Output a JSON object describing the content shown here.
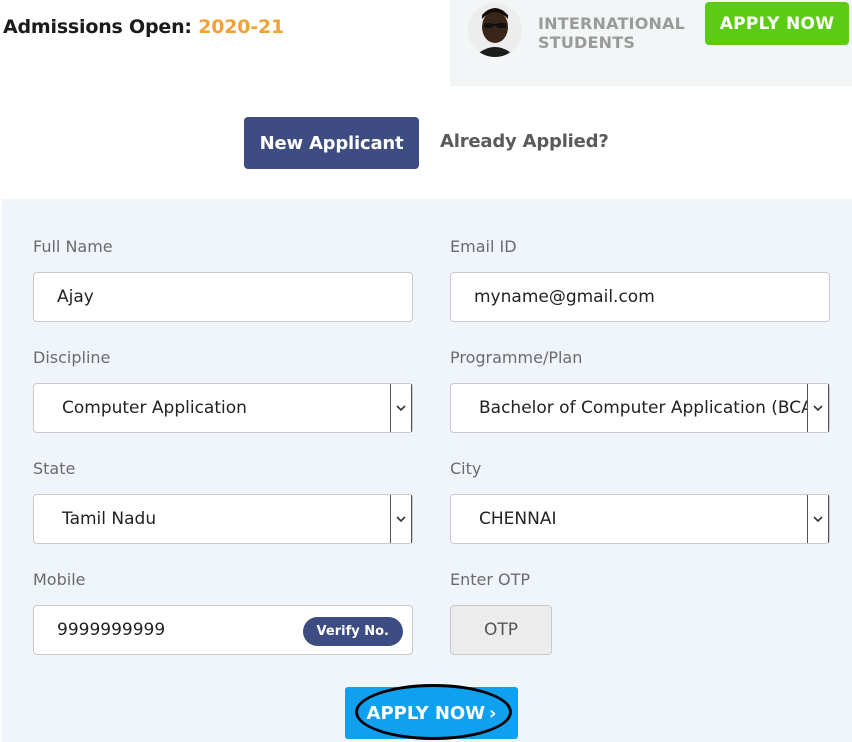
{
  "header": {
    "admissions_prefix": "Admissions Open:",
    "admissions_year": "2020-21",
    "intl_line1": "INTERNATIONAL",
    "intl_line2": "STUDENTS",
    "apply_label": "APPLY NOW"
  },
  "tabs": {
    "new_applicant": "New Applicant",
    "already_applied": "Already Applied?"
  },
  "form": {
    "full_name": {
      "label": "Full Name",
      "value": "Ajay"
    },
    "email": {
      "label": "Email ID",
      "value": "myname@gmail.com"
    },
    "discipline": {
      "label": "Discipline",
      "value": "Computer Application"
    },
    "programme": {
      "label": "Programme/Plan",
      "value": "Bachelor of Computer Application (BCA)"
    },
    "state": {
      "label": "State",
      "value": "Tamil Nadu"
    },
    "city": {
      "label": "City",
      "value": "CHENNAI"
    },
    "mobile": {
      "label": "Mobile",
      "value": "9999999999",
      "verify_label": "Verify No."
    },
    "otp": {
      "label": "Enter OTP",
      "placeholder": "OTP"
    },
    "submit_label": "APPLY NOW",
    "submit_arrow": "›"
  },
  "colors": {
    "brand_navy": "#3d4c82",
    "accent_green": "#5ccb13",
    "accent_blue": "#0fa0ef",
    "year_orange": "#f0a13a"
  },
  "icons": {
    "dropdown": "chevron-down-icon",
    "submit_arrow": "chevron-right-icon"
  }
}
